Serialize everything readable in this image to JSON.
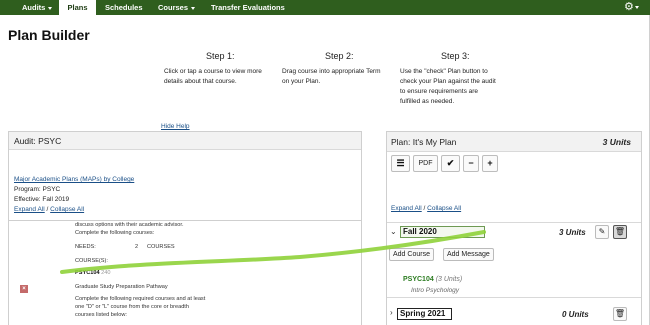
{
  "nav": {
    "items": [
      {
        "label": "Audits",
        "dropdown": true,
        "active": false
      },
      {
        "label": "Plans",
        "dropdown": false,
        "active": true
      },
      {
        "label": "Schedules",
        "dropdown": false,
        "active": false
      },
      {
        "label": "Courses",
        "dropdown": true,
        "active": false
      },
      {
        "label": "Transfer Evaluations",
        "dropdown": false,
        "active": false
      }
    ],
    "settings_icon": "gear-icon",
    "bar_color": "#2f5e1e"
  },
  "page": {
    "title": "Plan Builder"
  },
  "help": {
    "steps": [
      {
        "title": "Step 1:",
        "lines": [
          "Click or tap a course to view more",
          "details about that course."
        ]
      },
      {
        "title": "Step 2:",
        "lines": [
          "Drag course into appropriate Term",
          "on your Plan."
        ]
      },
      {
        "title": "Step 3:",
        "lines": [
          "Use the \"check\" Plan button to",
          "check your Plan against the audit",
          "to ensure requirements are",
          "fulfilled as needed."
        ]
      }
    ],
    "hide_label": "Hide Help"
  },
  "audit": {
    "title": "Audit: PSYC",
    "maps_link": "Major Academic Plans (MAPs) by College",
    "program": "Program: PSYC",
    "effective": "Effective: Fall 2019",
    "expand_all": "Expand All",
    "separator": "/",
    "collapse_all": "Collapse All",
    "requirements": {
      "advisor_line": "discuss options with their academic advisor.",
      "complete_line": "Complete the following courses:",
      "needs_label": "NEEDS:",
      "needs_value": "2",
      "needs_unit": "COURSES",
      "courses_label": "COURSE(S):",
      "course_code": "PSYC104",
      "course_extra": "240",
      "status_icon": "x-icon",
      "pathway_title": "Graduate Study Preparation Pathway",
      "pathway_lines": [
        "Complete the following required courses and at least",
        "one \"D\" or \"L\" course from the core or breadth",
        "courses listed below:"
      ]
    }
  },
  "plan": {
    "title": "Plan: It's My Plan",
    "units": "3 Units",
    "toolbar": {
      "pdf_label": "PDF",
      "list_icon": "list-icon",
      "check_icon": "check-icon",
      "minus_icon": "minus-icon",
      "plus_icon": "plus-icon"
    },
    "expand_all": "Expand All",
    "separator": "/",
    "collapse_all": "Collapse All",
    "terms": [
      {
        "name": "Fall 2020",
        "units": "3 Units",
        "expanded": true,
        "add_course_label": "Add Course",
        "add_message_label": "Add Message",
        "courses": [
          {
            "code": "PSYC104",
            "units": "(3 Units)",
            "title": "Intro Psychology"
          }
        ]
      },
      {
        "name": "Spring 2021",
        "units": "0 Units",
        "expanded": false
      }
    ]
  },
  "drag_highlight_color": "#8fd13a"
}
